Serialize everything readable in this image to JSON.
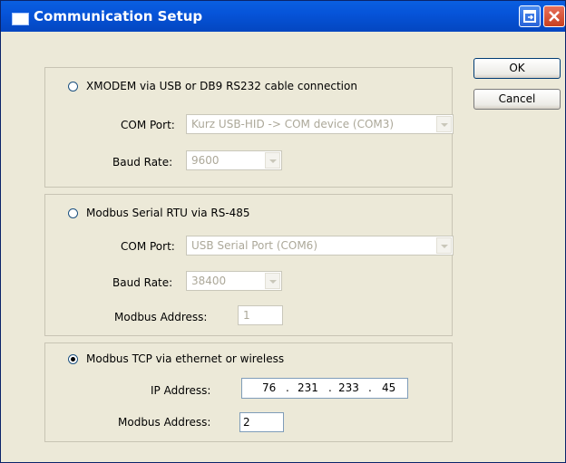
{
  "window": {
    "title": "Communication Setup"
  },
  "buttons": {
    "ok": "OK",
    "cancel": "Cancel"
  },
  "xmodem": {
    "label": "XMODEM via USB or DB9 RS232 cable connection",
    "selected": false,
    "com_port_label": "COM Port:",
    "com_port_value": "Kurz USB-HID -> COM device (COM3)",
    "baud_label": "Baud Rate:",
    "baud_value": "9600"
  },
  "modbus_rtu": {
    "label": "Modbus Serial RTU via RS-485",
    "selected": false,
    "com_port_label": "COM Port:",
    "com_port_value": "USB Serial Port (COM6)",
    "baud_label": "Baud Rate:",
    "baud_value": "38400",
    "address_label": "Modbus Address:",
    "address_value": "1"
  },
  "modbus_tcp": {
    "label": "Modbus TCP via ethernet or wireless",
    "selected": true,
    "ip_label": "IP Address:",
    "ip": [
      "76",
      "231",
      "233",
      "45"
    ],
    "ip_dot": ".",
    "address_label": "Modbus Address:",
    "address_value": "2"
  }
}
